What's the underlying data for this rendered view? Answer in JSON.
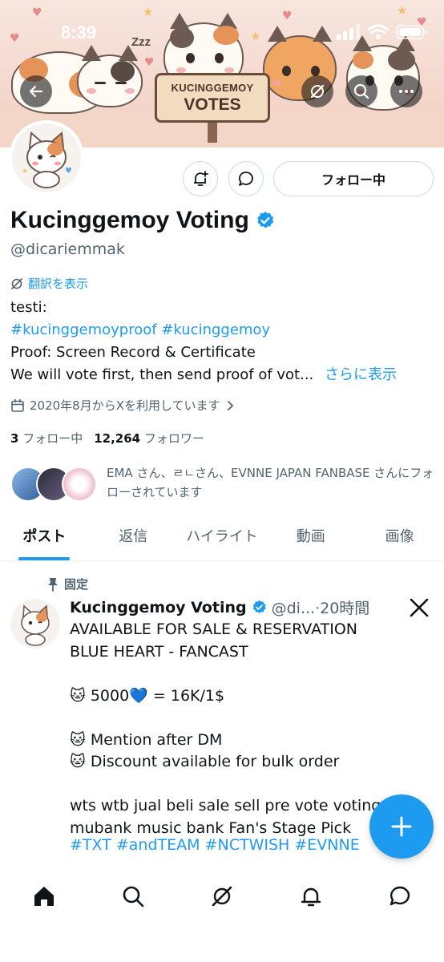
{
  "status_bar": {
    "time": "8:39"
  },
  "banner": {
    "sign_line1": "KUCINGGEMOY",
    "sign_line2": "VOTES",
    "snore": "Zzz"
  },
  "profile": {
    "display_name": "Kucinggemoy Voting",
    "handle": "@dicariemmak",
    "translate_label": "翻訳を表示",
    "bio_line1": "testi:",
    "bio_hashtags": "#kucinggemoyproof #kucinggemoy",
    "bio_line3": "Proof: Screen Record & Certificate",
    "bio_line4": "We will vote first, then send proof of vot...",
    "show_more": "さらに表示",
    "joined": "2020年8月からXを利用しています",
    "following_count": "3",
    "following_label": "フォロー中",
    "followers_count": "12,264",
    "followers_label": "フォロワー",
    "followed_by_text": "EMA さん、ㄹㄴさん、EVNNE JAPAN FANBASE さんにフォローされています",
    "follow_button": "フォロー中"
  },
  "tabs": [
    {
      "label": "ポスト"
    },
    {
      "label": "返信"
    },
    {
      "label": "ハイライト"
    },
    {
      "label": "動画"
    },
    {
      "label": "画像"
    }
  ],
  "pinned_tweet": {
    "pinned_label": "固定",
    "author": "Kucinggemoy Voting",
    "handle_meta": "@di...·20時間",
    "body": "AVAILABLE FOR SALE & RESERVATION\nBLUE HEART - FANCAST\n\n🐱 5000💙 = 16K/1$\n\n🐱 Mention after DM\n🐱 Discount available for bulk order\n\nwts wtb jual beli sale sell pre vote voting\nmubank music bank Fan's Stage Pick",
    "hashtags": "#TXT #andTEAM #NCTWISH #EVNNE"
  },
  "colors": {
    "accent": "#1d9bf0",
    "text_primary": "#0f1419",
    "text_secondary": "#536471"
  },
  "icons": {
    "back": "back-arrow-icon",
    "grok": "grok-icon",
    "search": "search-icon",
    "more": "more-icon",
    "notify": "bell-plus-icon",
    "message": "message-icon",
    "verified": "verified-badge-icon",
    "calendar": "calendar-icon",
    "pin": "pin-icon",
    "x_logo": "x-logo-icon",
    "compose": "plus-icon"
  }
}
